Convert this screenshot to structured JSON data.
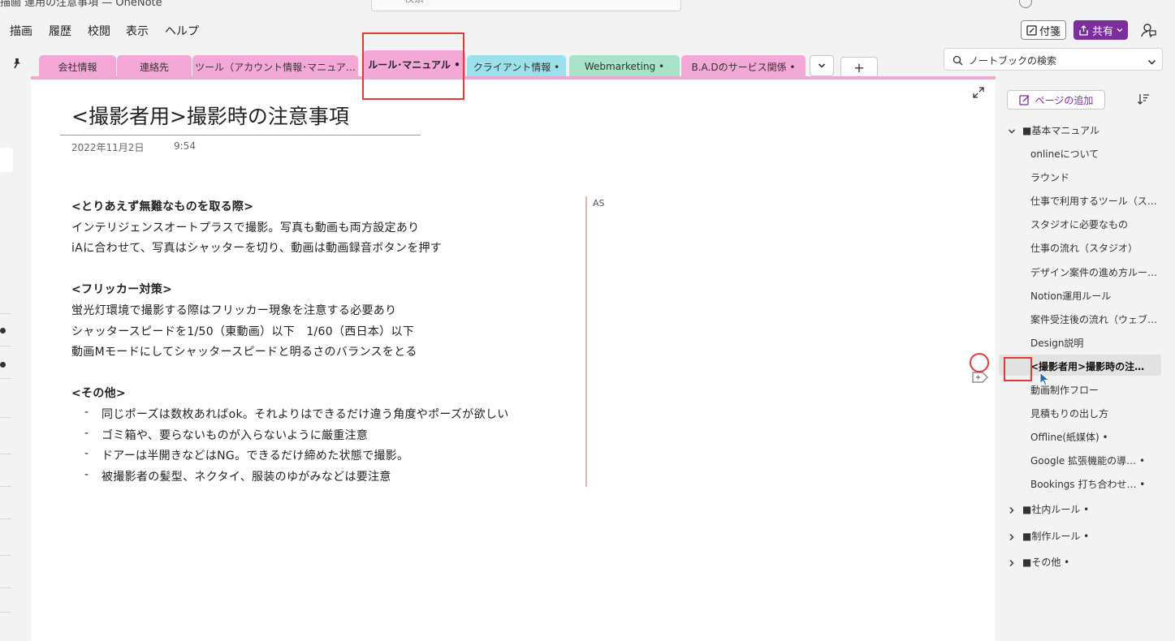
{
  "window": {
    "title_fragment": "描画 運用の注意事項 — OneNote",
    "search_fragment": "検索"
  },
  "menu": {
    "items": [
      "描画",
      "履歴",
      "校閲",
      "表示",
      "ヘルプ"
    ],
    "sticky_notes": "付箋",
    "share": "共有"
  },
  "tabs": [
    {
      "label": "会社情報",
      "color": "#f4a8d8"
    },
    {
      "label": "連絡先",
      "color": "#f4a8d8"
    },
    {
      "label": "ツール（アカウント情報･マニュア…",
      "color": "#f4a8d8"
    },
    {
      "label": "ルール･マニュアル •",
      "color": "#f4a8d8",
      "active": true
    },
    {
      "label": "クライアント情報 •",
      "color": "#9be0ea"
    },
    {
      "label": "Webmarketing •",
      "color": "#a8e2c8"
    },
    {
      "label": "B.A.Dのサービス関係 •",
      "color": "#f4a8d8"
    }
  ],
  "tab_add": "+",
  "notebook_search": {
    "placeholder": "ノートブックの検索"
  },
  "page": {
    "title": "<撮影者用>撮影時の注意事項",
    "date": "2022年11月2日",
    "time": "9:54",
    "author": "AS",
    "lines": [
      {
        "text": "<とりあえず無難なものを取る際>",
        "bold": true
      },
      {
        "text": "インテリジェンスオートプラスで撮影。写真も動画も両方設定あり"
      },
      {
        "text": "iAに合わせて、写真はシャッターを切り、動画は動画録音ボタンを押す"
      },
      {
        "text": "<フリッカー対策>",
        "bold": true
      },
      {
        "text": "蛍光灯環境で撮影する際はフリッカー現象を注意する必要あり"
      },
      {
        "text": "シャッタースピードを1/50（東動画）以下　1/60（西日本）以下"
      },
      {
        "text": "動画Mモードにしてシャッタースピードと明るさのバランスをとる"
      },
      {
        "text": "<その他>",
        "bold": true
      }
    ],
    "bullets": [
      "同じポーズは数枚あればok。それよりはできるだけ違う角度やポーズが欲しい",
      "ゴミ箱や、要らないものが入らないように厳重注意",
      "ドアーは半開きなどはNG。できるだけ締めた状態で撮影。",
      "被撮影者の髪型、ネクタイ、服装のゆがみなどは要注意"
    ],
    "bullet_marker": "-"
  },
  "pages_panel": {
    "add_page": "ページの追加",
    "section_open": "■基本マニュアル",
    "subpages": [
      "onlineについて",
      "ラウンド",
      "仕事で利用するツール（ス…",
      "スタジオに必要なもの",
      "仕事の流れ（スタジオ）",
      "デザイン案件の進め方ルー…",
      "Notion運用ルール",
      "案件受注後の流れ（ウェブ…",
      "Design説明",
      "<撮影者用>撮影時の注…",
      "動画制作フロー",
      "見積もりの出し方",
      "Offline(紙媒体) •",
      "Google 拡張機能の導… •",
      "Bookings 打ち合わせ… •"
    ],
    "selected_index": 9,
    "collapsed_sections": [
      "■社内ルール •",
      "■制作ルール •",
      "■その他 •"
    ]
  },
  "colors": {
    "accent": "#7b2f9e",
    "section_pink": "#ecaad2",
    "annotation_red": "#e53935"
  },
  "icons": [
    "pin-icon",
    "search-icon",
    "chevron-down-icon",
    "expand-icon",
    "sort-icon",
    "add-page-icon",
    "note-icon",
    "cursor-icon",
    "feedback-icon",
    "sticky-note-icon",
    "share-icon"
  ]
}
